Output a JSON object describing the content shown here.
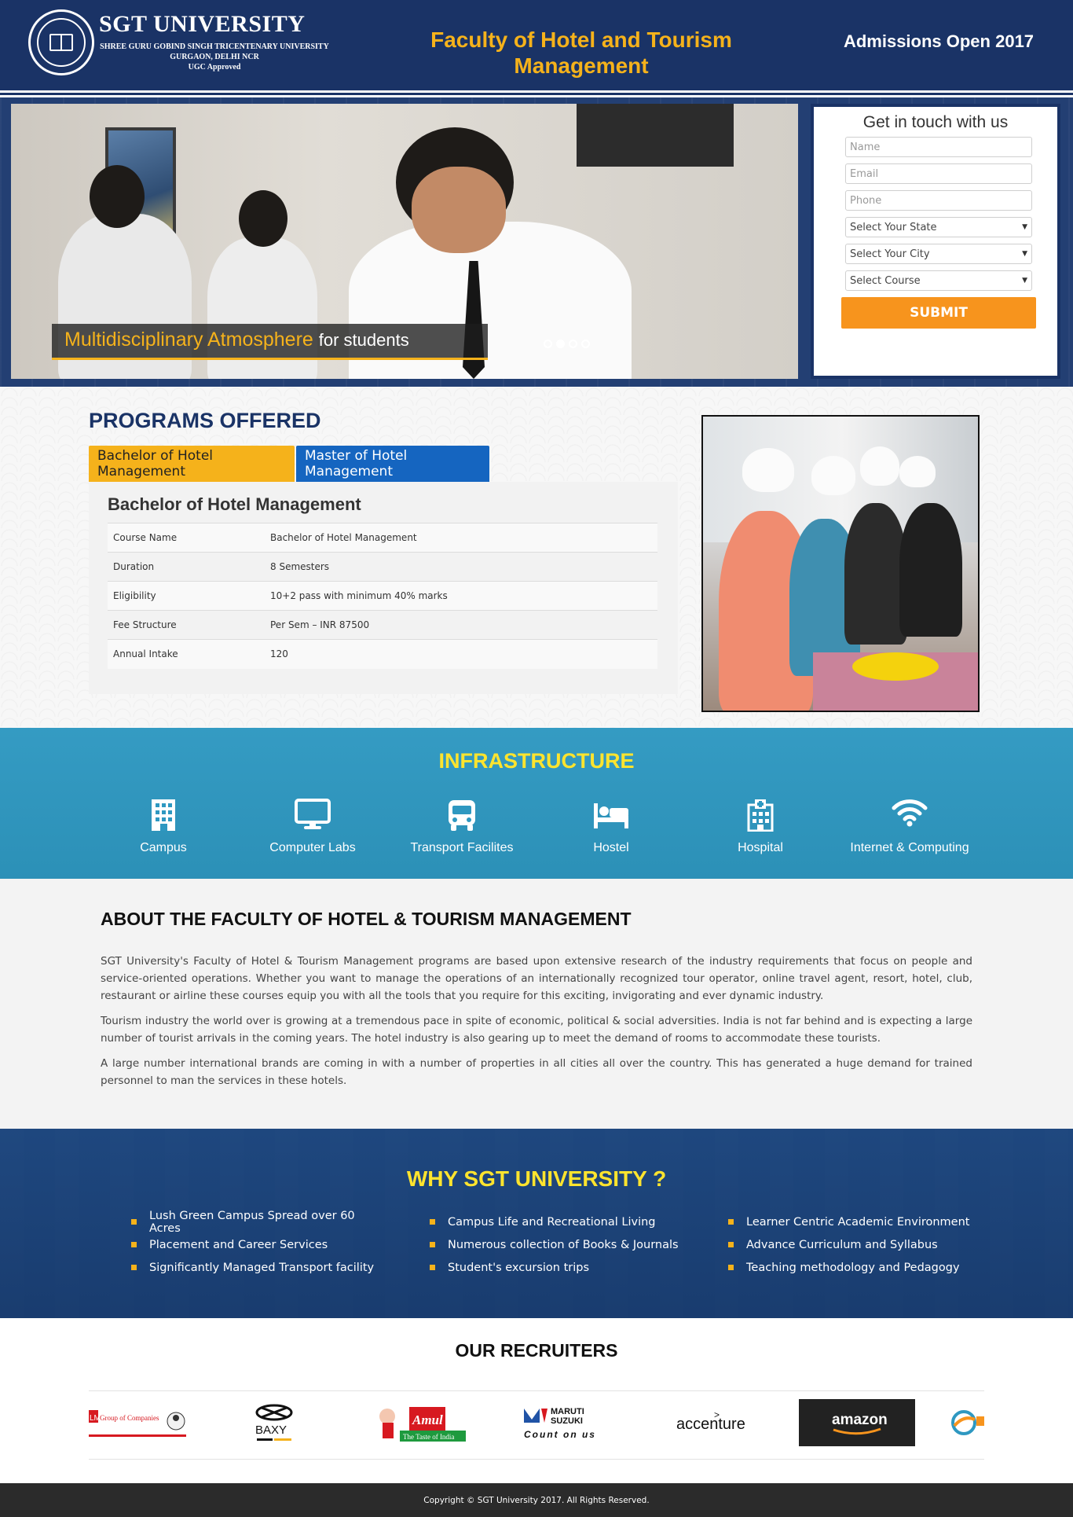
{
  "header": {
    "brand_name": "SGT UNIVERSITY",
    "brand_line1": "SHREE GURU GOBIND SINGH TRICENTENARY UNIVERSITY",
    "brand_line2": "GURGAON, DELHI NCR",
    "brand_line3": "UGC Approved",
    "faculty_title": "Faculty of Hotel and Tourism Management",
    "admissions": "Admissions Open 2017"
  },
  "hero": {
    "caption_highlight": "Multidisciplinary Atmosphere",
    "caption_rest": "for students",
    "slide_count": 4,
    "active_slide": 2
  },
  "form": {
    "title": "Get in touch with us",
    "name_placeholder": "Name",
    "email_placeholder": "Email",
    "phone_placeholder": "Phone",
    "state_select": "Select Your State",
    "city_select": "Select Your City",
    "course_select": "Select Course",
    "submit_label": "SUBMIT"
  },
  "programs": {
    "title": "PROGRAMS OFFERED",
    "tabs": [
      "Bachelor of Hotel Management",
      "Master of Hotel Management"
    ],
    "active_tab": 0,
    "panel_heading": "Bachelor of Hotel Management",
    "rows": [
      {
        "key": "Course Name",
        "value": "Bachelor of Hotel Management"
      },
      {
        "key": "Duration",
        "value": "8 Semesters"
      },
      {
        "key": "Eligibility",
        "value": "10+2 pass with minimum 40% marks"
      },
      {
        "key": "Fee Structure",
        "value": "Per Sem – INR 87500"
      },
      {
        "key": "Annual Intake",
        "value": "120"
      }
    ]
  },
  "infrastructure": {
    "title": "INFRASTRUCTURE",
    "items": [
      {
        "label": "Campus",
        "icon": "building-icon"
      },
      {
        "label": "Computer Labs",
        "icon": "monitor-icon"
      },
      {
        "label": "Transport Facilites",
        "icon": "bus-icon"
      },
      {
        "label": "Hostel",
        "icon": "bed-icon"
      },
      {
        "label": "Hospital",
        "icon": "hospital-icon"
      },
      {
        "label": "Internet & Computing",
        "icon": "wifi-icon"
      }
    ]
  },
  "about": {
    "title": "ABOUT THE FACULTY OF HOTEL & TOURISM MANAGEMENT",
    "paragraphs": [
      "SGT University's Faculty of Hotel & Tourism Management programs are based upon extensive research of the industry requirements that focus on people and service-oriented operations. Whether you want to manage the operations of an internationally recognized tour operator, online travel agent, resort, hotel, club, restaurant or airline these courses equip you with all the tools that you require for this exciting, invigorating and ever dynamic industry.",
      "Tourism industry the world over is growing at a tremendous pace in spite of economic, political & social adversities. India is not far behind and is expecting a large number of tourist arrivals in the coming years. The hotel industry is also gearing up to meet the demand of rooms to accommodate these tourists.",
      "A large number international brands are coming in with a number of properties in all cities all over the country. This has generated a huge demand for trained personnel to man the services in these hotels."
    ]
  },
  "why": {
    "title": "WHY SGT UNIVERSITY ?",
    "columns": [
      [
        "Lush Green Campus Spread over 60 Acres",
        "Placement and Career Services",
        "Significantly Managed Transport facility"
      ],
      [
        "Campus Life and Recreational Living",
        "Numerous collection of Books & Journals",
        "Student's excursion trips"
      ],
      [
        "Learner Centric Academic Environment",
        "Advance Curriculum and Syllabus",
        "Teaching methodology and Pedagogy"
      ]
    ]
  },
  "recruiters": {
    "title": "OUR RECRUITERS",
    "logos": [
      {
        "name": "lm-group-logo",
        "text": "Group of Companies"
      },
      {
        "name": "baxy-logo",
        "text": "BAXY"
      },
      {
        "name": "amul-logo",
        "text": "Amul",
        "tagline": "The Taste of India"
      },
      {
        "name": "maruti-suzuki-logo",
        "text": "MARUTI SUZUKI",
        "tagline": "Count on us"
      },
      {
        "name": "accenture-logo",
        "text": "accenture"
      },
      {
        "name": "amazon-logo",
        "text": "amazon"
      }
    ]
  },
  "footer": {
    "copyright": "Copyright © SGT University 2017. All Rights Reserved."
  },
  "colors": {
    "navy": "#1a3366",
    "gold": "#f5b21b",
    "orange": "#f7941d",
    "infra_blue": "#2e98c1",
    "tab_blue": "#1565c0",
    "yellow_title": "#ffe42e"
  }
}
